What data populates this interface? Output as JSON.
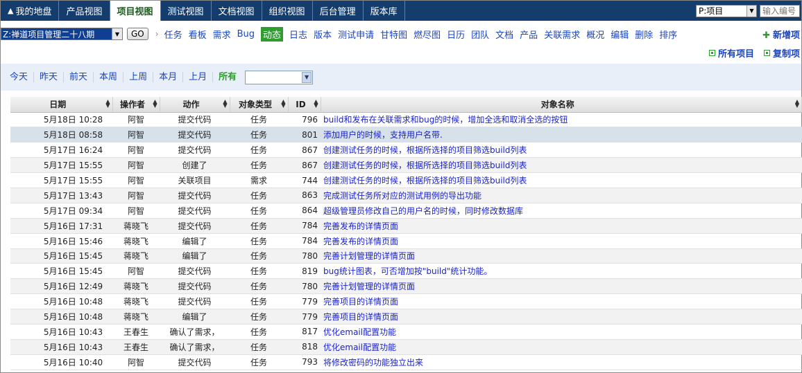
{
  "top_nav": {
    "tabs": [
      {
        "label": "我的地盘",
        "icon": "home-icon",
        "active": false
      },
      {
        "label": "产品视图",
        "active": false
      },
      {
        "label": "项目视图",
        "active": true
      },
      {
        "label": "测试视图",
        "active": false
      },
      {
        "label": "文档视图",
        "active": false
      },
      {
        "label": "组织视图",
        "active": false
      },
      {
        "label": "后台管理",
        "active": false
      },
      {
        "label": "版本库",
        "active": false
      }
    ],
    "search_type": "P:项目",
    "search_placeholder": "输入编号"
  },
  "sub_nav": {
    "project_select": "Z:禅道项目管理二十八期",
    "go_label": "GO",
    "separator": "›",
    "links": [
      "任务",
      "看板",
      "需求",
      "Bug",
      "动态",
      "日志",
      "版本",
      "测试申请",
      "甘特图",
      "燃尽图",
      "日历",
      "团队",
      "文档",
      "产品",
      "关联需求",
      "概况",
      "编辑",
      "删除",
      "排序"
    ],
    "active_link": "动态",
    "new_item": "新增项"
  },
  "third_row": {
    "all_projects": "所有项目",
    "copy_item": "复制项"
  },
  "filter_bar": {
    "items": [
      "今天",
      "昨天",
      "前天",
      "本周",
      "上周",
      "本月",
      "上月",
      "所有"
    ],
    "active": "所有",
    "select_value": ""
  },
  "table": {
    "headers": [
      "日期",
      "操作者",
      "动作",
      "对象类型",
      "ID",
      "对象名称"
    ],
    "rows": [
      [
        "5月18日 10:28",
        "阿智",
        "提交代码",
        "任务",
        "796",
        "build和发布在关联需求和bug的时候，增加全选和取消全选的按钮"
      ],
      [
        "5月18日 08:58",
        "阿智",
        "提交代码",
        "任务",
        "801",
        "添加用户的时候，支持用户名带."
      ],
      [
        "5月17日 16:24",
        "阿智",
        "提交代码",
        "任务",
        "867",
        "创建测试任务的时候，根据所选择的项目筛选build列表"
      ],
      [
        "5月17日 15:55",
        "阿智",
        "创建了",
        "任务",
        "867",
        "创建测试任务的时候，根据所选择的项目筛选build列表"
      ],
      [
        "5月17日 15:55",
        "阿智",
        "关联项目",
        "需求",
        "744",
        "创建测试任务的时候，根据所选择的项目筛选build列表"
      ],
      [
        "5月17日 13:43",
        "阿智",
        "提交代码",
        "任务",
        "863",
        "完成测试任务所对应的测试用例的导出功能"
      ],
      [
        "5月17日 09:34",
        "阿智",
        "提交代码",
        "任务",
        "864",
        "超级管理员修改自己的用户名的时候，同时修改数据库"
      ],
      [
        "5月16日 17:31",
        "蒋晓飞",
        "提交代码",
        "任务",
        "784",
        "完善发布的详情页面"
      ],
      [
        "5月16日 15:46",
        "蒋晓飞",
        "编辑了",
        "任务",
        "784",
        "完善发布的详情页面"
      ],
      [
        "5月16日 15:45",
        "蒋晓飞",
        "编辑了",
        "任务",
        "780",
        "完善计划管理的详情页面"
      ],
      [
        "5月16日 15:45",
        "阿智",
        "提交代码",
        "任务",
        "819",
        "bug统计图表，可否增加按\"build\"统计功能。"
      ],
      [
        "5月16日 12:49",
        "蒋晓飞",
        "提交代码",
        "任务",
        "780",
        "完善计划管理的详情页面"
      ],
      [
        "5月16日 10:48",
        "蒋晓飞",
        "提交代码",
        "任务",
        "779",
        "完善项目的详情页面"
      ],
      [
        "5月16日 10:48",
        "蒋晓飞",
        "编辑了",
        "任务",
        "779",
        "完善项目的详情页面"
      ],
      [
        "5月16日 10:43",
        "王春生",
        "确认了需求，",
        "任务",
        "817",
        "优化email配置功能"
      ],
      [
        "5月16日 10:43",
        "王春生",
        "确认了需求，",
        "任务",
        "818",
        "优化email配置功能"
      ],
      [
        "5月16日 10:40",
        "阿智",
        "提交代码",
        "任务",
        "793",
        "将修改密码的功能独立出来"
      ]
    ],
    "highlighted_row": 1
  }
}
